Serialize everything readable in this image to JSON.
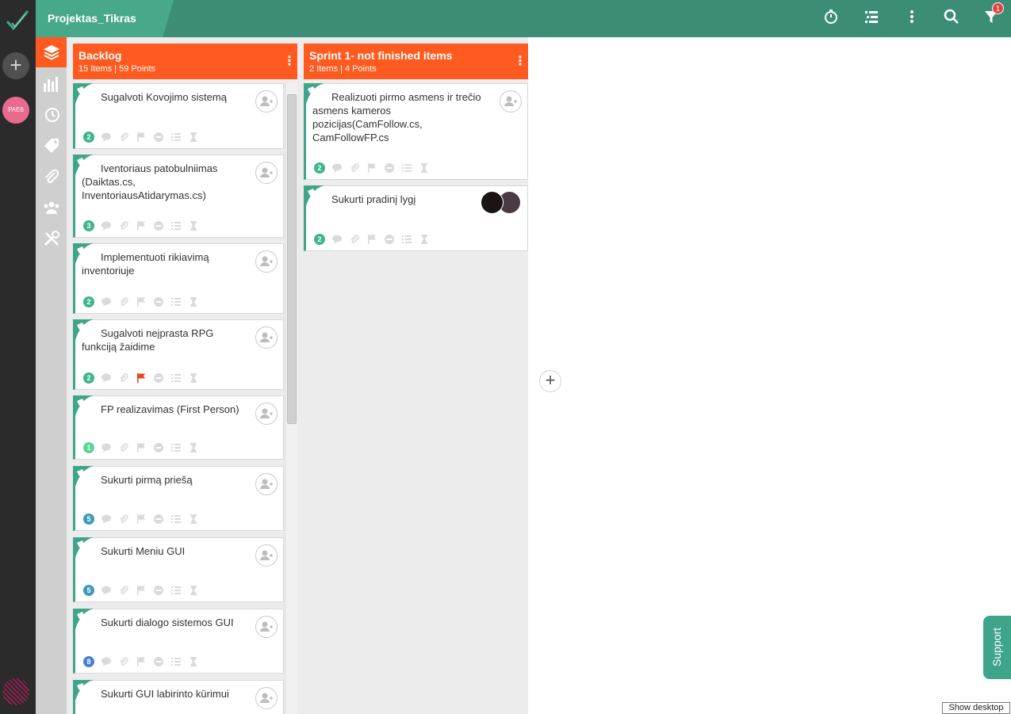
{
  "app": {
    "project_title": "Projektas_Tikras",
    "user_initials": "PAE6"
  },
  "topbar": {
    "icons": [
      "timer-icon",
      "list-icon",
      "more-vertical-icon",
      "search-icon",
      "filter-icon"
    ],
    "filter_badge": "1"
  },
  "sidebar": {
    "items": [
      {
        "icon": "layers-icon",
        "active": true
      },
      {
        "icon": "bar-chart-icon",
        "active": false
      },
      {
        "icon": "history-icon",
        "active": false
      },
      {
        "icon": "tag-icon",
        "active": false
      },
      {
        "icon": "paperclip-icon",
        "active": false
      },
      {
        "icon": "team-icon",
        "active": false
      },
      {
        "icon": "tools-icon",
        "active": false
      }
    ]
  },
  "columns": [
    {
      "title": "Backlog",
      "subtitle": "15 Items | 59 Points",
      "cards": [
        {
          "title": "Sugalvoti Kovojimo sistemą",
          "points": "2",
          "point_color": "#3fb58c",
          "flag": false
        },
        {
          "title": "Iventoriaus patobulniimas (Daiktas.cs, InventoriausAtidarymas.cs)",
          "points": "3",
          "point_color": "#3fb58c",
          "flag": false
        },
        {
          "title": "Implementuoti rikiavimą inventoriuje",
          "points": "2",
          "point_color": "#3fb58c",
          "flag": false
        },
        {
          "title": "Sugalvoti neįprasta RPG funkciją žaidime",
          "points": "2",
          "point_color": "#3fb58c",
          "flag": true
        },
        {
          "title": "FP realizavimas (First Person)",
          "points": "1",
          "point_color": "#5bd49a",
          "flag": false
        },
        {
          "title": "Sukurti pirmą priešą",
          "points": "5",
          "point_color": "#3d9bb8",
          "flag": false
        },
        {
          "title": "Sukurti Meniu GUI",
          "points": "5",
          "point_color": "#3d9bb8",
          "flag": false
        },
        {
          "title": "Sukurti dialogo sistemos GUI",
          "points": "8",
          "point_color": "#4a7fd4",
          "flag": false
        },
        {
          "title": "Sukurti GUI labirinto kūrimui",
          "points": "",
          "point_color": "#3fb58c",
          "flag": false
        }
      ]
    },
    {
      "title": "Sprint 1- not finished items",
      "subtitle": "2 Items | 4 Points",
      "cards": [
        {
          "title": "Realizuoti pirmo asmens ir trečio asmens kameros pozicijas(CamFollow.cs, CamFollowFP.cs",
          "points": "2",
          "point_color": "#3fb58c",
          "flag": false
        },
        {
          "title": "Sukurti pradinį lygį",
          "points": "2",
          "point_color": "#3fb58c",
          "flag": false
        }
      ]
    }
  ],
  "support_label": "Support",
  "show_desktop_label": "Show desktop",
  "colors": {
    "accent": "#ff5a1f",
    "brand": "#3b8e75",
    "card_border": "#3fa58a",
    "flag": "#e8421e"
  }
}
